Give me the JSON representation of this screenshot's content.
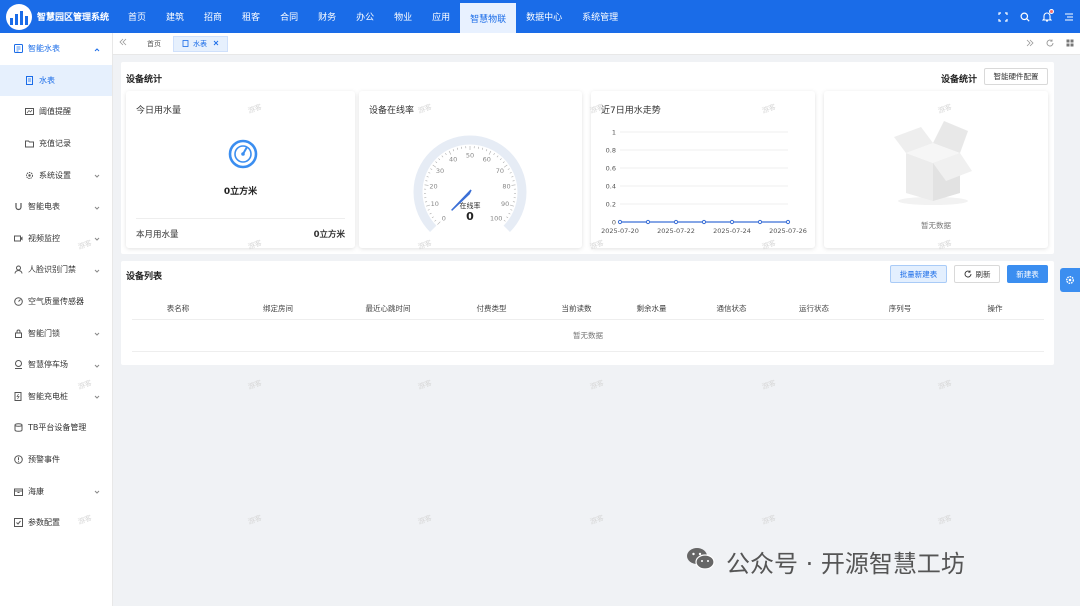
{
  "app": {
    "name": "智慧园区管理系统"
  },
  "nav": [
    {
      "label": "首页"
    },
    {
      "label": "建筑"
    },
    {
      "label": "招商"
    },
    {
      "label": "租客"
    },
    {
      "label": "合同"
    },
    {
      "label": "财务"
    },
    {
      "label": "办公"
    },
    {
      "label": "物业"
    },
    {
      "label": "应用"
    },
    {
      "label": "智慧物联",
      "active": true
    },
    {
      "label": "数据中心"
    },
    {
      "label": "系统管理"
    }
  ],
  "top_icons": [
    "fullscreen-icon",
    "search-icon",
    "bell-icon",
    "menu-icon"
  ],
  "sidebar": {
    "group": "智能水表",
    "sub_items": [
      {
        "label": "水表",
        "icon": "document-icon",
        "active": true
      },
      {
        "label": "阈值提醒",
        "icon": "alert-icon"
      },
      {
        "label": "充值记录",
        "icon": "folder-icon"
      },
      {
        "label": "系统设置",
        "icon": "gear-icon"
      }
    ],
    "items": [
      {
        "label": "智能电表",
        "icon": "magnet-icon",
        "chevron": true
      },
      {
        "label": "视频监控",
        "icon": "video-icon",
        "chevron": true
      },
      {
        "label": "人脸识别门禁",
        "icon": "person-icon",
        "chevron": true
      },
      {
        "label": "空气质量传感器",
        "icon": "sensor-icon",
        "chevron": false
      },
      {
        "label": "智能门锁",
        "icon": "lock-icon",
        "chevron": true
      },
      {
        "label": "智慧停车场",
        "icon": "parking-icon",
        "chevron": true
      },
      {
        "label": "智能充电桩",
        "icon": "charger-icon",
        "chevron": true
      },
      {
        "label": "TB平台设备管理",
        "icon": "database-icon",
        "chevron": false
      },
      {
        "label": "预警事件",
        "icon": "warning-icon",
        "chevron": false
      },
      {
        "label": "海康",
        "icon": "box-icon",
        "chevron": true
      },
      {
        "label": "参数配置",
        "icon": "config-icon",
        "chevron": false
      }
    ]
  },
  "tabs": {
    "home": "首页",
    "current": "水表"
  },
  "stats": {
    "title": "设备统计",
    "right_label": "设备统计",
    "config_button": "智能硬件配置",
    "today": {
      "title": "今日用水量",
      "value": "0立方米",
      "month_label": "本月用水量",
      "month_value": "0立方米"
    },
    "online": {
      "title": "设备在线率",
      "gauge_label": "在线率",
      "gauge_value": "0",
      "ticks": [
        "0",
        "10",
        "20",
        "30",
        "40",
        "50",
        "60",
        "70",
        "80",
        "90",
        "100"
      ]
    },
    "trend": {
      "title": "近7日用水走势"
    },
    "empty": {
      "text": "暂无数据"
    }
  },
  "chart_data": {
    "type": "line",
    "title": "近7日用水走势",
    "x": [
      "2025-07-20",
      "2025-07-21",
      "2025-07-22",
      "2025-07-23",
      "2025-07-24",
      "2025-07-25",
      "2025-07-26"
    ],
    "x_tick_labels": [
      "2025-07-20",
      "2025-07-22",
      "2025-07-24",
      "2025-07-26"
    ],
    "values": [
      0,
      0,
      0,
      0,
      0,
      0,
      0
    ],
    "y_ticks": [
      "0",
      "0.2",
      "0.4",
      "0.6",
      "0.8",
      "1"
    ],
    "ylim": [
      0,
      1
    ],
    "grid": true,
    "color": "#3b6fd6"
  },
  "device_list": {
    "title": "设备列表",
    "batch_button": "批量新建表",
    "refresh_button": "刷新",
    "new_button": "新建表",
    "columns": [
      "表名称",
      "绑定房间",
      "最近心跳时间",
      "付费类型",
      "当前读数",
      "剩余水量",
      "通信状态",
      "运行状态",
      "序列号",
      "操作"
    ],
    "empty_text": "暂无数据"
  },
  "watermark_text": "游客",
  "footer_brand": "公众号 · 开源智慧工坊",
  "colors": {
    "primary": "#1a6ce8",
    "accent": "#3b8ef0"
  }
}
